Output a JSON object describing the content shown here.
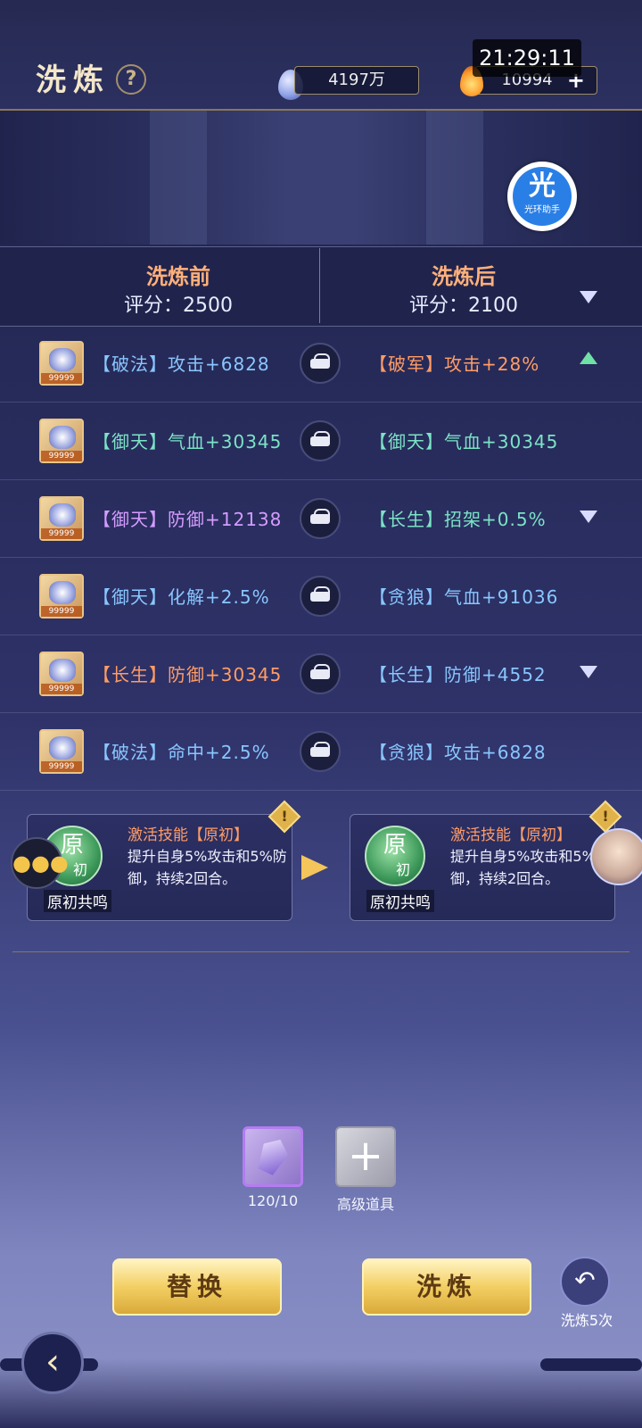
{
  "header": {
    "title": "洗炼",
    "help_icon": "question-icon",
    "currency_gem": "4197万",
    "currency_gem_icon": "gem-drop-icon",
    "currency_fire": "10994",
    "currency_fire_icon": "fire-drop-icon",
    "time": "21:29:11"
  },
  "assistant": {
    "char": "光",
    "label": "光环助手"
  },
  "compare": {
    "before_title": "洗炼前",
    "before_score": "评分：2500",
    "after_title": "洗炼后",
    "after_score": "评分：2100"
  },
  "rows": [
    {
      "before": "【破法】攻击+6828",
      "before_color": "#89c6ff",
      "after": "【破军】攻击+28%",
      "after_color": "#ff9c66",
      "trend": "up",
      "stars": "99999"
    },
    {
      "before": "【御天】气血+30345",
      "before_color": "#7be3c6",
      "after": "【御天】气血+30345",
      "after_color": "#7be3c6",
      "trend": "none",
      "stars": "99999"
    },
    {
      "before": "【御天】防御+12138",
      "before_color": "#d59cff",
      "after": "【长生】招架+0.5%",
      "after_color": "#7be3c6",
      "trend": "down",
      "stars": "99999"
    },
    {
      "before": "【御天】化解+2.5%",
      "before_color": "#89c6ff",
      "after": "【贪狼】气血+91036",
      "after_color": "#89c6ff",
      "trend": "none",
      "stars": "99999"
    },
    {
      "before": "【长生】防御+30345",
      "before_color": "#ff9c66",
      "after": "【长生】防御+4552",
      "after_color": "#89c6ff",
      "trend": "down",
      "stars": "99999"
    },
    {
      "before": "【破法】命中+2.5%",
      "before_color": "#89c6ff",
      "after": "【贪狼】攻击+6828",
      "after_color": "#89c6ff",
      "trend": "none",
      "stars": "99999"
    }
  ],
  "skill_before": {
    "orb_main": "原",
    "orb_sub": "初",
    "name": "原初共鸣",
    "title": "激活技能【原初】",
    "desc": "提升自身5%攻击和5%防御，持续2回合。"
  },
  "skill_after": {
    "orb_main": "原",
    "orb_sub": "初",
    "name": "原初共鸣",
    "title": "激活技能【原初】",
    "desc": "提升自身5%攻击和5%防御，持续2回合。"
  },
  "materials": {
    "item1_count": "120/10",
    "item2_label": "高级道具"
  },
  "buttons": {
    "replace": "替换",
    "refine": "洗炼",
    "multi_refine": "洗炼5次"
  }
}
